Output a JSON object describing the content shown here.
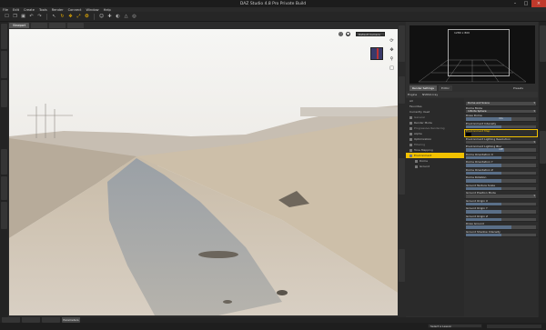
{
  "window": {
    "title": "DAZ Studio 4.8 Pro Private Build"
  },
  "menu": [
    "File",
    "Edit",
    "Create",
    "Tools",
    "Render",
    "Connect",
    "Window",
    "Help"
  ],
  "toolbar_icons": [
    "new-icon",
    "open-icon",
    "save-icon",
    "undo-icon",
    "redo-icon",
    "select-icon",
    "rotate-icon",
    "translate-icon",
    "scale-icon",
    "node-weight-icon",
    "pose-icon",
    "joint-editor-icon",
    "surface-icon",
    "geometry-icon",
    "render-icon"
  ],
  "viewport": {
    "tabs": [
      "Viewport",
      "",
      "",
      ""
    ],
    "camera_label": "Default Camera"
  },
  "aux": {
    "frame_label": "1280 x 800"
  },
  "panel": {
    "tabs": [
      "Render Settings",
      "Editor"
    ],
    "presets_label": "Presets",
    "engine_label": "Engine",
    "engine_value": "NVIDIA Iray",
    "tree": [
      {
        "label": "All",
        "state": "normal"
      },
      {
        "label": "Favorites",
        "state": "normal"
      },
      {
        "label": "Currently Used",
        "state": "normal"
      },
      {
        "label": "General",
        "state": "dim"
      },
      {
        "label": "Render Mode",
        "state": "normal"
      },
      {
        "label": "Progressive Rendering",
        "state": "dim"
      },
      {
        "label": "Alpha",
        "state": "normal"
      },
      {
        "label": "Optimization",
        "state": "normal"
      },
      {
        "label": "Filtering",
        "state": "dim"
      },
      {
        "label": "Tone Mapping",
        "state": "normal"
      },
      {
        "label": "Environment",
        "state": "selected"
      },
      {
        "label": "Dome",
        "state": "normal"
      },
      {
        "label": "Ground",
        "state": "normal"
      }
    ],
    "props": [
      {
        "label": "",
        "kind": "dd",
        "value": "Dome and Scene",
        "fill": 0
      },
      {
        "label": "Dome Mode",
        "kind": "dd",
        "value": "Infinite Sphere",
        "fill": 0
      },
      {
        "label": "Draw Dome",
        "kind": "slider",
        "value": "On",
        "fill": 0.65
      },
      {
        "label": "Environment Intensity",
        "kind": "slider",
        "value": "",
        "fill": 0.5
      },
      {
        "label": "Environment Map",
        "kind": "color",
        "value": "",
        "fill": 0
      },
      {
        "label": "Environment Lighting Resolution",
        "kind": "dd",
        "value": "",
        "fill": 0
      },
      {
        "label": "Environment Lighting Blur",
        "kind": "slider",
        "value": "Off",
        "fill": 0.55
      },
      {
        "label": "Dome Orientation X",
        "kind": "slider",
        "value": "",
        "fill": 0.5
      },
      {
        "label": "Dome Orientation Y",
        "kind": "slider",
        "value": "",
        "fill": 0.5
      },
      {
        "label": "Dome Orientation Z",
        "kind": "slider",
        "value": "",
        "fill": 0.5
      },
      {
        "label": "Dome Rotation",
        "kind": "slider",
        "value": "",
        "fill": 0.5
      },
      {
        "label": "Ground Texture Scale",
        "kind": "slider",
        "value": "",
        "fill": 0.5
      },
      {
        "label": "Ground Position Mode",
        "kind": "dd",
        "value": "",
        "fill": 0
      },
      {
        "label": "Ground Origin X",
        "kind": "slider",
        "value": "",
        "fill": 0.5
      },
      {
        "label": "Ground Origin Y",
        "kind": "slider",
        "value": "",
        "fill": 0.5
      },
      {
        "label": "Ground Origin Z",
        "kind": "slider",
        "value": "",
        "fill": 0.5
      },
      {
        "label": "Draw Ground",
        "kind": "slider",
        "value": "",
        "fill": 0.65
      },
      {
        "label": "Ground Shadow Intensity",
        "kind": "slider",
        "value": "",
        "fill": 0.5
      }
    ],
    "show_sub_items": "Show Sub Items",
    "tips_label": "Tips"
  },
  "bottom_tabs": [
    "",
    "",
    "",
    "Parameters"
  ],
  "status": {
    "lesson_label": "Select a Lesson"
  },
  "colors": {
    "accent": "#f2c100",
    "bg": "#2b2b2b"
  }
}
